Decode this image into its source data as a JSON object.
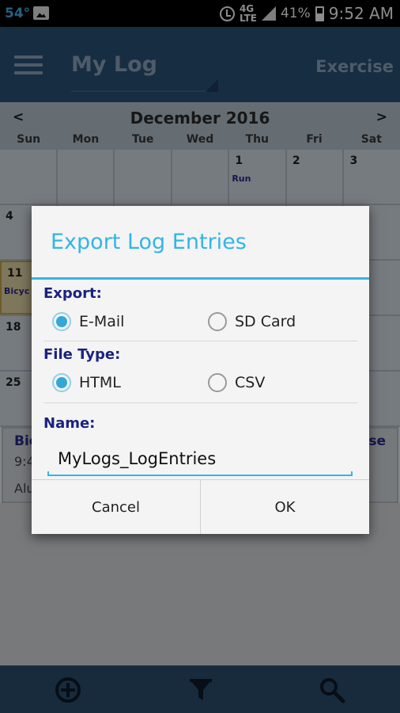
{
  "status_bar": {
    "temperature": "54°",
    "battery_percent": "41%",
    "time": "9:52 AM",
    "network": "4G LTE",
    "icons": [
      "photo-icon",
      "alarm-icon",
      "lte-icon",
      "signal-icon",
      "battery-icon"
    ]
  },
  "appbar": {
    "title": "My Log",
    "action": "Exercise",
    "menu_icon": "hamburger-menu-icon"
  },
  "calendar": {
    "month": "December 2016",
    "prev": "<",
    "next": ">",
    "weekdays": [
      "Sun",
      "Mon",
      "Tue",
      "Wed",
      "Thu",
      "Fri",
      "Sat"
    ],
    "weeks": [
      [
        {
          "day": ""
        },
        {
          "day": ""
        },
        {
          "day": ""
        },
        {
          "day": ""
        },
        {
          "day": "1",
          "entry": "Run"
        },
        {
          "day": "2"
        },
        {
          "day": "3"
        }
      ],
      [
        {
          "day": "4"
        },
        {
          "day": ""
        },
        {
          "day": ""
        },
        {
          "day": ""
        },
        {
          "day": ""
        },
        {
          "day": ""
        },
        {
          "day": ""
        }
      ],
      [
        {
          "day": "11",
          "entry": "Bicyc"
        },
        {
          "day": ""
        },
        {
          "day": ""
        },
        {
          "day": ""
        },
        {
          "day": ""
        },
        {
          "day": ""
        },
        {
          "day": ""
        }
      ],
      [
        {
          "day": "18"
        },
        {
          "day": ""
        },
        {
          "day": ""
        },
        {
          "day": ""
        },
        {
          "day": ""
        },
        {
          "day": ""
        },
        {
          "day": ""
        }
      ],
      [
        {
          "day": "25"
        },
        {
          "day": ""
        },
        {
          "day": ""
        },
        {
          "day": ""
        },
        {
          "day": ""
        },
        {
          "day": ""
        },
        {
          "day": ""
        }
      ]
    ]
  },
  "details": {
    "title": "Bic",
    "time": "9:4",
    "location": "Alu",
    "right": "ise"
  },
  "dialog": {
    "title": "Export Log Entries",
    "export_label": "Export:",
    "export_options": [
      {
        "label": "E-Mail",
        "checked": true
      },
      {
        "label": "SD Card",
        "checked": false
      }
    ],
    "filetype_label": "File Type:",
    "filetype_options": [
      {
        "label": "HTML",
        "checked": true
      },
      {
        "label": "CSV",
        "checked": false
      }
    ],
    "name_label": "Name:",
    "name_value": "MyLogs_LogEntries",
    "cancel_label": "Cancel",
    "ok_label": "OK"
  },
  "toolbar": {
    "icons": [
      "add-icon",
      "filter-icon",
      "search-icon"
    ]
  },
  "colors": {
    "accent": "#33b5e5",
    "appbar": "#2a5279",
    "label": "#1a237e",
    "radio_checked": "#33a7d9"
  }
}
